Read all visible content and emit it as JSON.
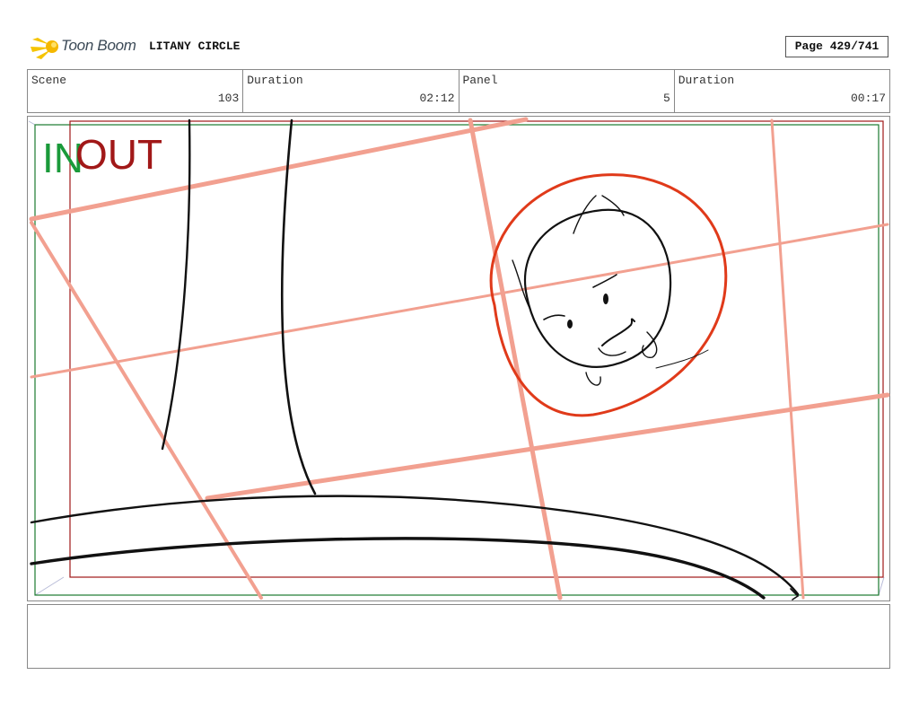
{
  "header": {
    "logo_text": "Toon Boom",
    "project_title": "LITANY CIRCLE",
    "page": "Page 429/741"
  },
  "info": [
    {
      "label": "Scene",
      "value": "103"
    },
    {
      "label": "Duration",
      "value": "02:12"
    },
    {
      "label": "Panel",
      "value": "5"
    },
    {
      "label": "Duration",
      "value": "00:17"
    }
  ],
  "frame_labels": {
    "in": "IN",
    "out": "OUT"
  },
  "colors": {
    "in_frame": "#1a9a3a",
    "out_frame": "#a11818",
    "guide_lines": "#f2a090",
    "circle": "#e03a1a",
    "ink": "#111111"
  },
  "notes": ""
}
